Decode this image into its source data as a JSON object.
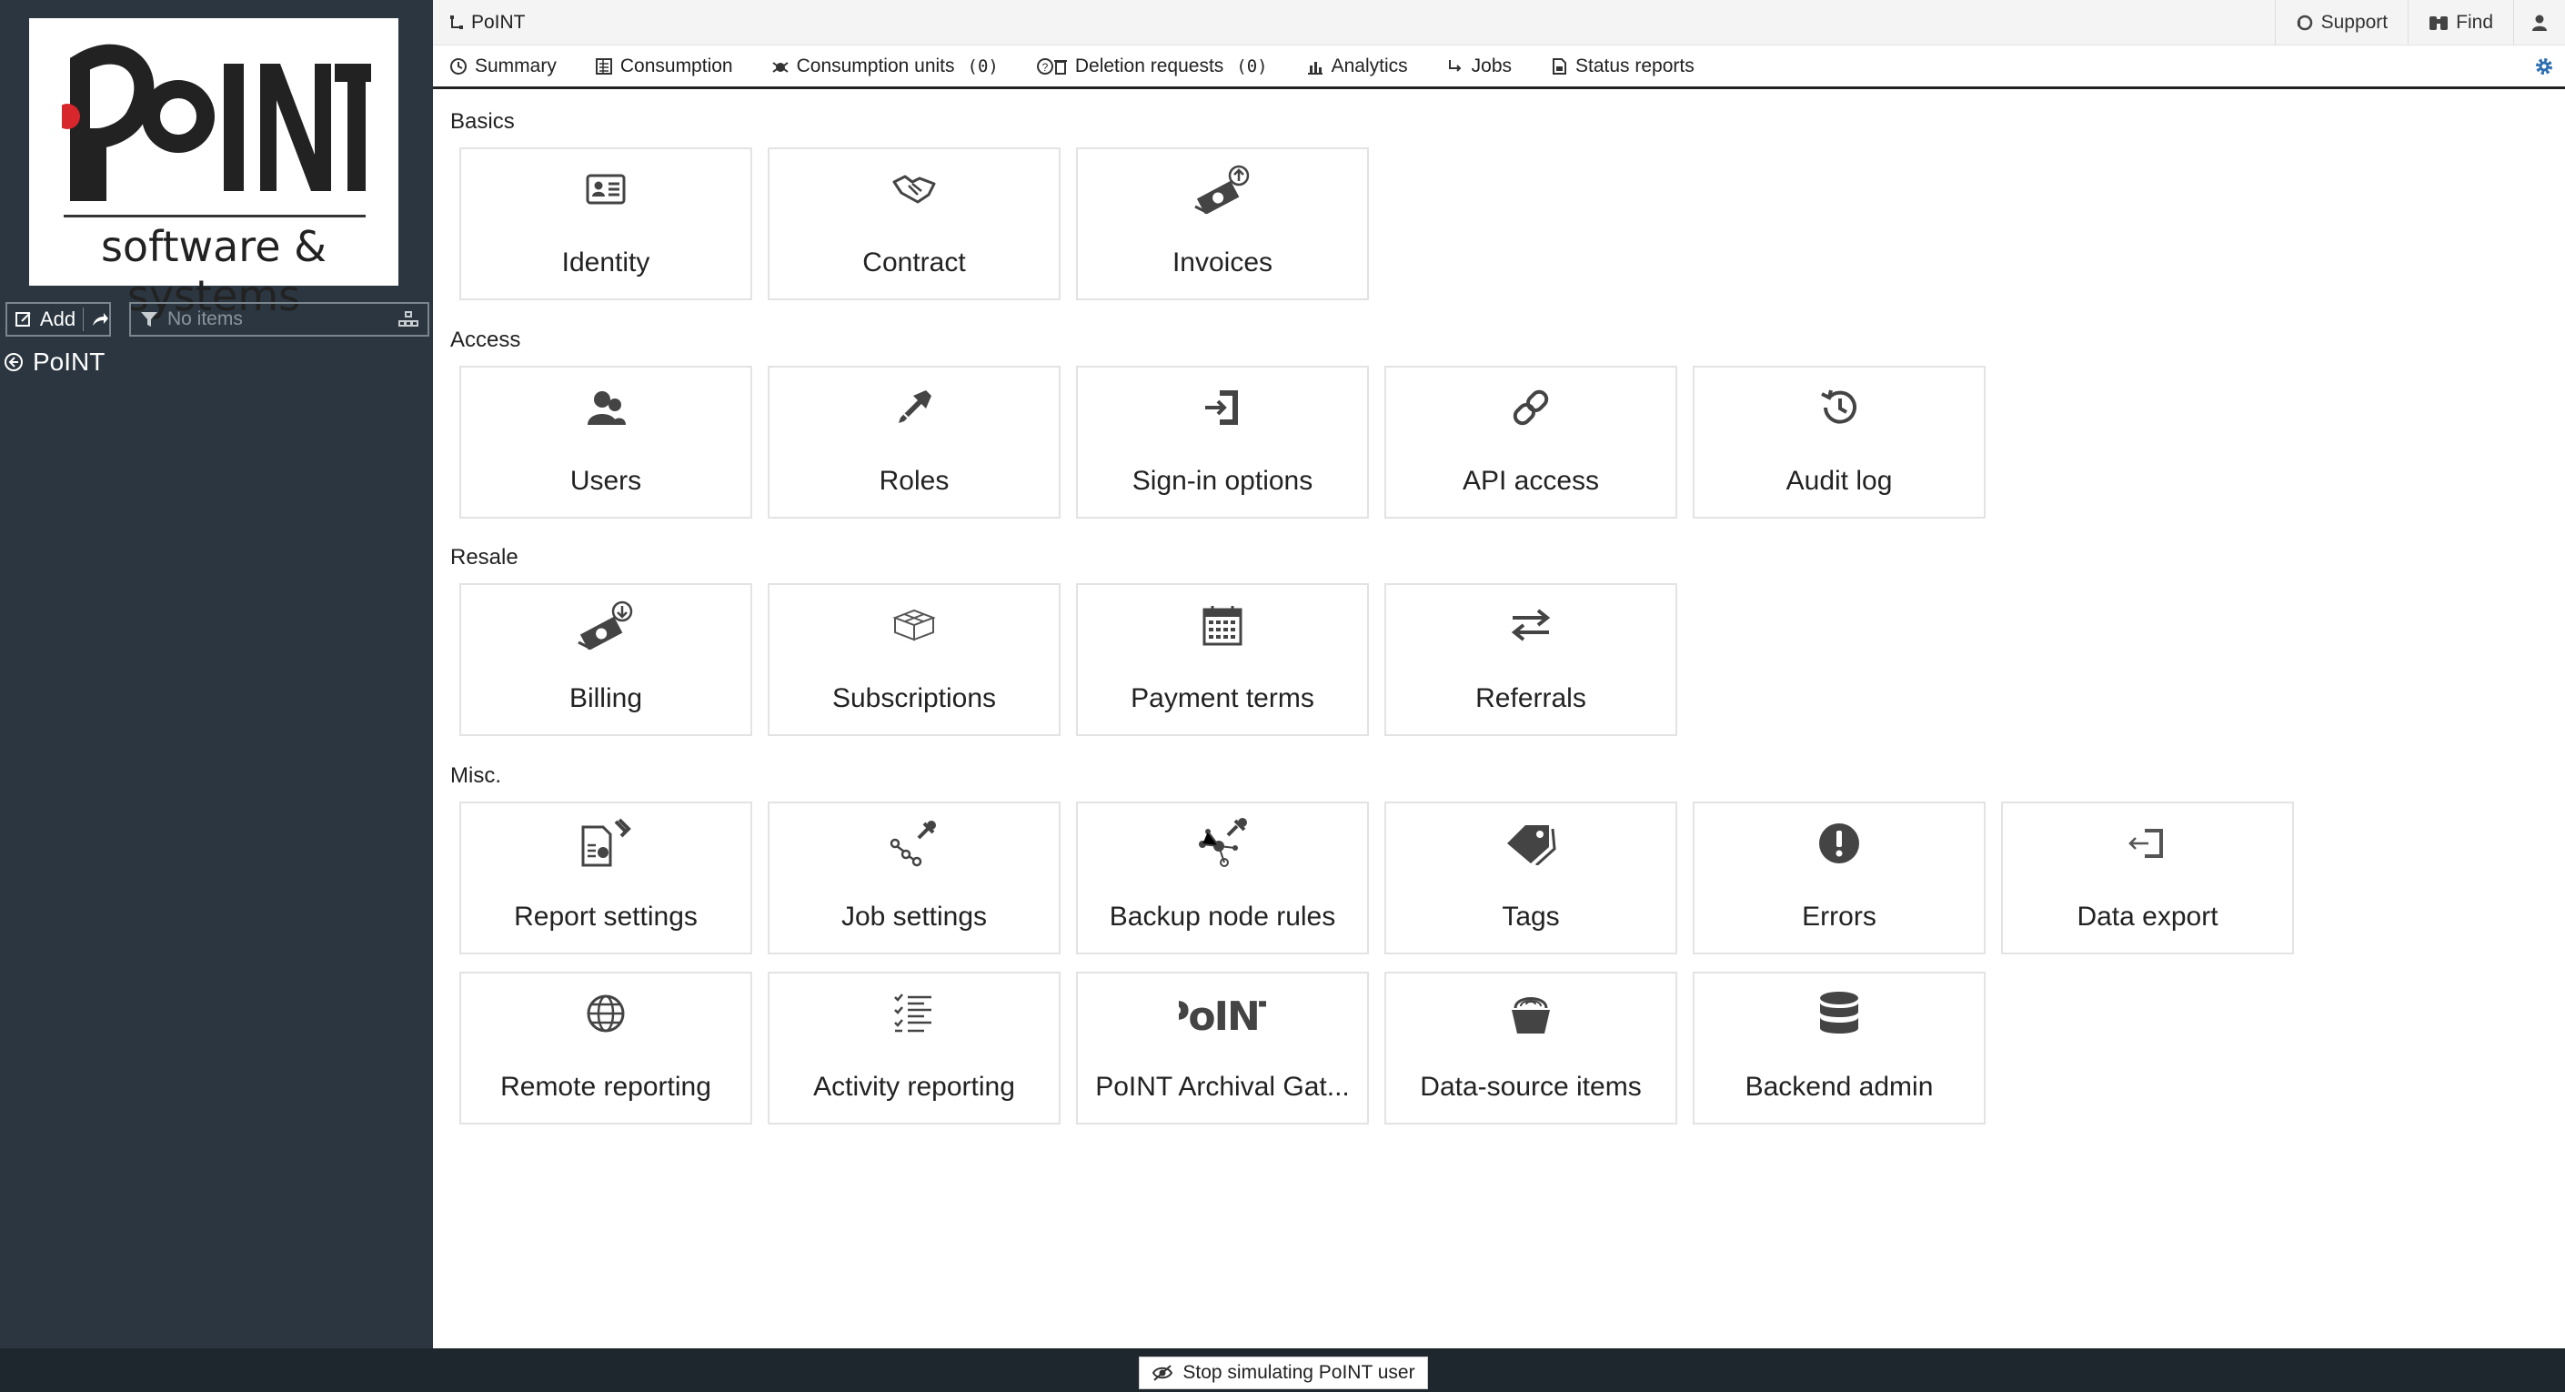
{
  "brand": {
    "logo_text": "PoINT",
    "logo_subtitle": "software & systems",
    "logo_accent": "#d7262c"
  },
  "sidebar": {
    "add_label": "Add",
    "filter_placeholder": "No items",
    "tree_root": "PoINT"
  },
  "header": {
    "breadcrumb": "PoINT",
    "support_label": "Support",
    "find_label": "Find"
  },
  "nav": {
    "tabs": [
      {
        "label": "Summary",
        "icon": "clock-icon"
      },
      {
        "label": "Consumption",
        "icon": "ledger-icon"
      },
      {
        "label": "Consumption units",
        "icon": "bug-icon",
        "count": "(0)"
      },
      {
        "label": "Deletion requests",
        "icon": "trash-question-icon",
        "count": "(0)"
      },
      {
        "label": "Analytics",
        "icon": "bar-chart-icon"
      },
      {
        "label": "Jobs",
        "icon": "jobs-icon"
      },
      {
        "label": "Status reports",
        "icon": "report-icon"
      }
    ]
  },
  "sections": [
    {
      "title": "Basics",
      "tiles": [
        {
          "label": "Identity",
          "icon": "id-card-icon"
        },
        {
          "label": "Contract",
          "icon": "handshake-icon"
        },
        {
          "label": "Invoices",
          "icon": "money-upload-icon"
        }
      ]
    },
    {
      "title": "Access",
      "tiles": [
        {
          "label": "Users",
          "icon": "users-icon"
        },
        {
          "label": "Roles",
          "icon": "key-icon"
        },
        {
          "label": "Sign-in options",
          "icon": "sign-in-icon"
        },
        {
          "label": "API access",
          "icon": "link-icon"
        },
        {
          "label": "Audit log",
          "icon": "history-icon"
        }
      ]
    },
    {
      "title": "Resale",
      "tiles": [
        {
          "label": "Billing",
          "icon": "money-download-icon"
        },
        {
          "label": "Subscriptions",
          "icon": "boxes-icon"
        },
        {
          "label": "Payment terms",
          "icon": "calendar-icon"
        },
        {
          "label": "Referrals",
          "icon": "exchange-icon"
        }
      ]
    },
    {
      "title": "Misc.",
      "tiles": [
        {
          "label": "Report settings",
          "icon": "report-settings-icon"
        },
        {
          "label": "Job settings",
          "icon": "job-settings-icon"
        },
        {
          "label": "Backup node rules",
          "icon": "nodes-wrench-icon"
        },
        {
          "label": "Tags",
          "icon": "tags-icon"
        },
        {
          "label": "Errors",
          "icon": "exclamation-circle-icon"
        },
        {
          "label": "Data export",
          "icon": "export-icon"
        },
        {
          "label": "Remote reporting",
          "icon": "globe-icon"
        },
        {
          "label": "Activity reporting",
          "icon": "checklist-icon"
        },
        {
          "label": "PoINT Archival Gat...",
          "icon": "point-logo-icon",
          "icon_text": "PoINT"
        },
        {
          "label": "Data-source items",
          "icon": "bucket-icon"
        },
        {
          "label": "Backend admin",
          "icon": "database-icon"
        }
      ]
    }
  ],
  "footer": {
    "stop_label": "Stop simulating PoINT user"
  }
}
